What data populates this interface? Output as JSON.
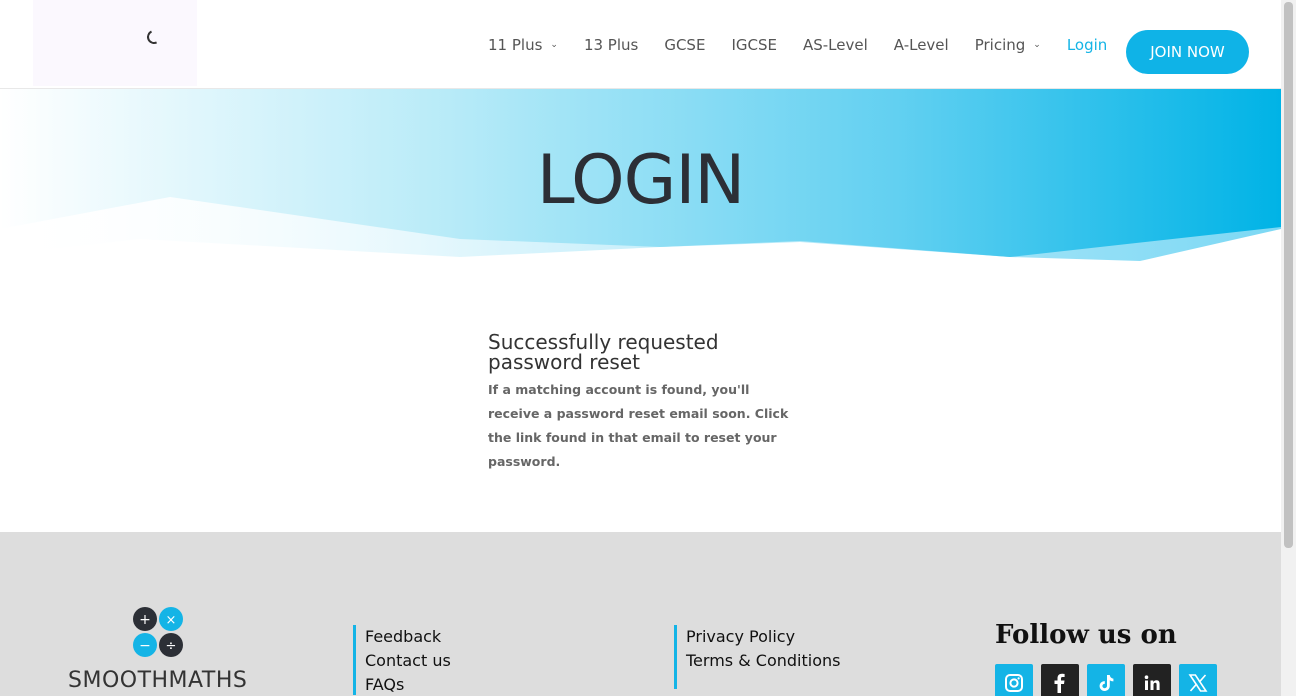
{
  "nav": {
    "items": [
      {
        "label": "11 Plus",
        "chevron": true
      },
      {
        "label": "13 Plus",
        "chevron": false
      },
      {
        "label": "GCSE",
        "chevron": false
      },
      {
        "label": "IGCSE",
        "chevron": false
      },
      {
        "label": "AS-Level",
        "chevron": false
      },
      {
        "label": "A-Level",
        "chevron": false
      },
      {
        "label": "Pricing",
        "chevron": true
      },
      {
        "label": "Login",
        "chevron": false,
        "active": true
      }
    ],
    "join_label": "JOIN NOW",
    "chevron_glyph": "⌄"
  },
  "hero": {
    "title": "LOGIN"
  },
  "message": {
    "heading": "Successfully requested password reset",
    "body": "If a matching account is found, you'll receive a password reset email soon. Click the link found in that email to reset your password."
  },
  "footer": {
    "logo_text": "SMOOTHMATHS",
    "col1": [
      "Feedback",
      "Contact us",
      "FAQs"
    ],
    "col2": [
      "Privacy Policy",
      "Terms & Conditions"
    ],
    "follow_title": "Follow us on",
    "socials": [
      {
        "icon": "instagram-icon",
        "color": "#14b4e6"
      },
      {
        "icon": "facebook-icon",
        "color": "#222222"
      },
      {
        "icon": "tiktok-icon",
        "color": "#14b4e6"
      },
      {
        "icon": "linkedin-icon",
        "color": "#222222"
      },
      {
        "icon": "x-icon",
        "color": "#14b4e6"
      }
    ]
  },
  "colors": {
    "accent": "#14b4e6",
    "dark": "#2c2f36",
    "footer_bg": "#dddddd"
  }
}
